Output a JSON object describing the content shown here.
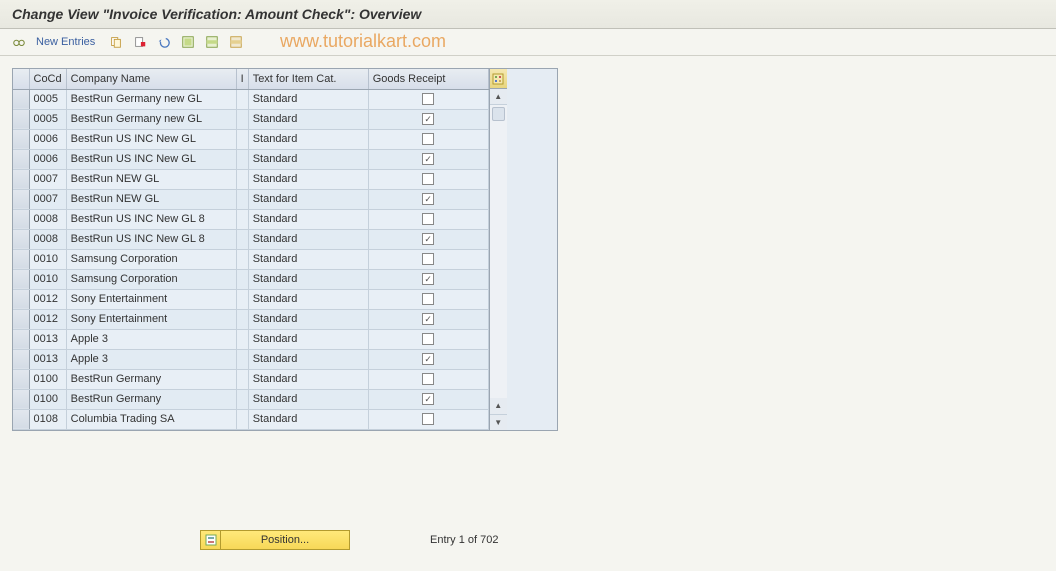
{
  "title": "Change View \"Invoice Verification: Amount Check\": Overview",
  "toolbar": {
    "new_entries_label": "New Entries"
  },
  "watermark": "www.tutorialkart.com",
  "table": {
    "headers": {
      "cocd": "CoCd",
      "name": "Company Name",
      "i": "I",
      "text": "Text for Item Cat.",
      "gr": "Goods Receipt"
    },
    "rows": [
      {
        "cocd": "0005",
        "name": "BestRun Germany new GL",
        "i": "",
        "text": "Standard",
        "gr": false
      },
      {
        "cocd": "0005",
        "name": "BestRun Germany new GL",
        "i": "",
        "text": "Standard",
        "gr": true
      },
      {
        "cocd": "0006",
        "name": "BestRun US INC New GL",
        "i": "",
        "text": "Standard",
        "gr": false
      },
      {
        "cocd": "0006",
        "name": "BestRun US INC New GL",
        "i": "",
        "text": "Standard",
        "gr": true
      },
      {
        "cocd": "0007",
        "name": "BestRun NEW GL",
        "i": "",
        "text": "Standard",
        "gr": false
      },
      {
        "cocd": "0007",
        "name": "BestRun NEW GL",
        "i": "",
        "text": "Standard",
        "gr": true
      },
      {
        "cocd": "0008",
        "name": "BestRun US INC New GL 8",
        "i": "",
        "text": "Standard",
        "gr": false
      },
      {
        "cocd": "0008",
        "name": "BestRun US INC New GL 8",
        "i": "",
        "text": "Standard",
        "gr": true
      },
      {
        "cocd": "0010",
        "name": "Samsung Corporation",
        "i": "",
        "text": "Standard",
        "gr": false
      },
      {
        "cocd": "0010",
        "name": "Samsung Corporation",
        "i": "",
        "text": "Standard",
        "gr": true
      },
      {
        "cocd": "0012",
        "name": "Sony Entertainment",
        "i": "",
        "text": "Standard",
        "gr": false
      },
      {
        "cocd": "0012",
        "name": "Sony Entertainment",
        "i": "",
        "text": "Standard",
        "gr": true
      },
      {
        "cocd": "0013",
        "name": "Apple 3",
        "i": "",
        "text": "Standard",
        "gr": false
      },
      {
        "cocd": "0013",
        "name": "Apple 3",
        "i": "",
        "text": "Standard",
        "gr": true
      },
      {
        "cocd": "0100",
        "name": "BestRun Germany",
        "i": "",
        "text": "Standard",
        "gr": false
      },
      {
        "cocd": "0100",
        "name": "BestRun Germany",
        "i": "",
        "text": "Standard",
        "gr": true
      },
      {
        "cocd": "0108",
        "name": "Columbia Trading SA",
        "i": "",
        "text": "Standard",
        "gr": false
      }
    ]
  },
  "footer": {
    "position_label": "Position...",
    "entry_status": "Entry 1 of 702"
  }
}
